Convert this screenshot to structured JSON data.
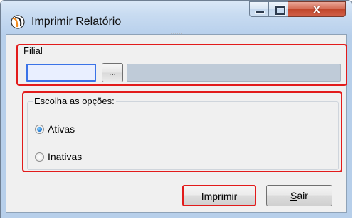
{
  "window": {
    "title": "Imprimir Relatório",
    "controls": {
      "minimize": "minimize",
      "maximize": "maximize",
      "close": "x"
    }
  },
  "filial": {
    "label": "Filial",
    "input_value": "",
    "lookup_label": "...",
    "description_value": ""
  },
  "options": {
    "label": "Escolha as opções:",
    "items": [
      {
        "label": "Ativas",
        "checked": true
      },
      {
        "label": "Inativas",
        "checked": false
      }
    ]
  },
  "buttons": {
    "print": {
      "label_prefix": "I",
      "label_suffix": "mprimir"
    },
    "exit": {
      "label_prefix": "S",
      "label_suffix": "air"
    }
  },
  "colors": {
    "highlight_border": "#e21b1b",
    "focused_input_border": "#3b73e7",
    "radio_selected": "#2f86d9",
    "title_bar": "#c9dcf1",
    "close_button": "#c0452a"
  },
  "icons": {
    "app": "app-logo-icon",
    "minimize": "minimize-icon",
    "maximize": "maximize-icon",
    "close": "close-icon",
    "radio": "radio-icon"
  }
}
